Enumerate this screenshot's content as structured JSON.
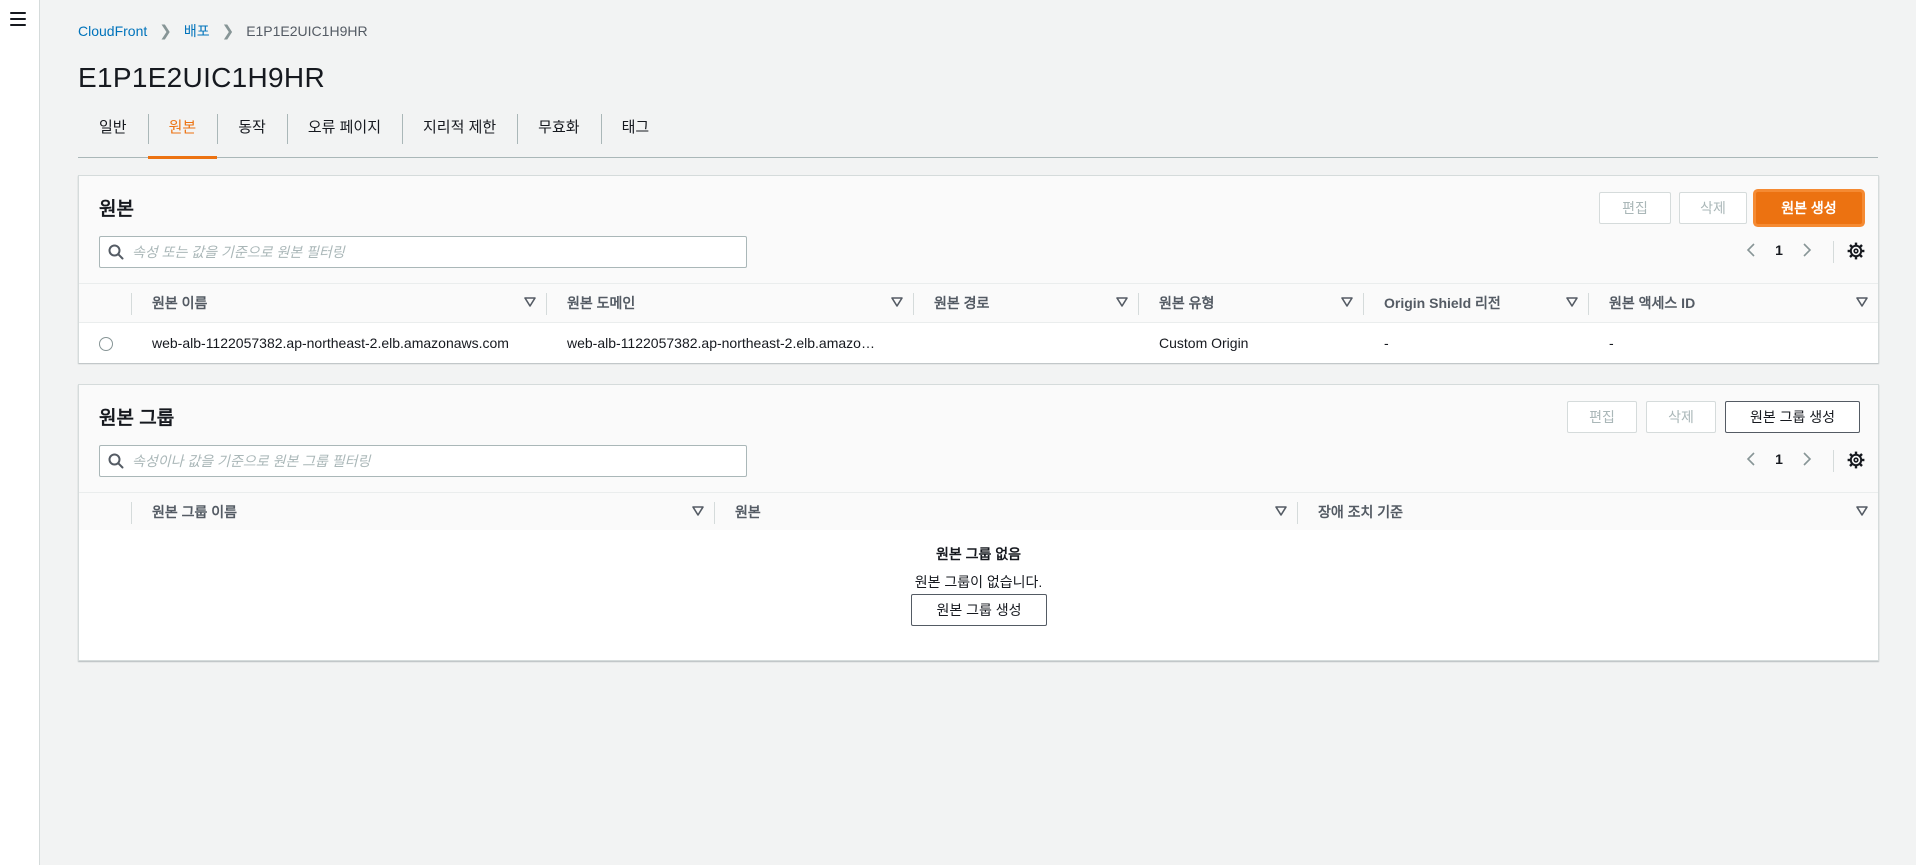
{
  "nav": {
    "menu_icon": "hamburger-menu-icon"
  },
  "breadcrumb": {
    "items": [
      {
        "label": "CloudFront"
      },
      {
        "label": "배포"
      }
    ],
    "current": "E1P1E2UIC1H9HR"
  },
  "page": {
    "title": "E1P1E2UIC1H9HR"
  },
  "tabs": [
    {
      "label": "일반"
    },
    {
      "label": "원본",
      "active": true
    },
    {
      "label": "동작"
    },
    {
      "label": "오류 페이지"
    },
    {
      "label": "지리적 제한"
    },
    {
      "label": "무효화"
    },
    {
      "label": "태그"
    }
  ],
  "origins": {
    "title": "원본",
    "edit_label": "편집",
    "delete_label": "삭제",
    "create_label": "원본 생성",
    "search_placeholder": "속성 또는 값을 기준으로 원본 필터링",
    "page": "1",
    "columns": [
      "원본 이름",
      "원본 도메인",
      "원본 경로",
      "원본 유형",
      "Origin Shield 리전",
      "원본 액세스 ID"
    ],
    "rows": [
      {
        "name": "web-alb-1122057382.ap-northeast-2.elb.amazonaws.com",
        "domain": "web-alb-1122057382.ap-northeast-2.elb.amazo…",
        "path": "",
        "type": "Custom Origin",
        "shield_region": "-",
        "access_id": "-"
      }
    ]
  },
  "origin_groups": {
    "title": "원본 그룹",
    "edit_label": "편집",
    "delete_label": "삭제",
    "create_label": "원본 그룹 생성",
    "search_placeholder": "속성이나 값을 기준으로 원본 그룹 필터링",
    "page": "1",
    "columns": [
      "원본 그룹 이름",
      "원본",
      "장애 조치 기준"
    ],
    "empty_title": "원본 그룹 없음",
    "empty_desc": "원본 그룹이 없습니다.",
    "empty_create_label": "원본 그룹 생성"
  },
  "colors": {
    "accent": "#ec7211",
    "link": "#0073bb",
    "text": "#16191f"
  }
}
